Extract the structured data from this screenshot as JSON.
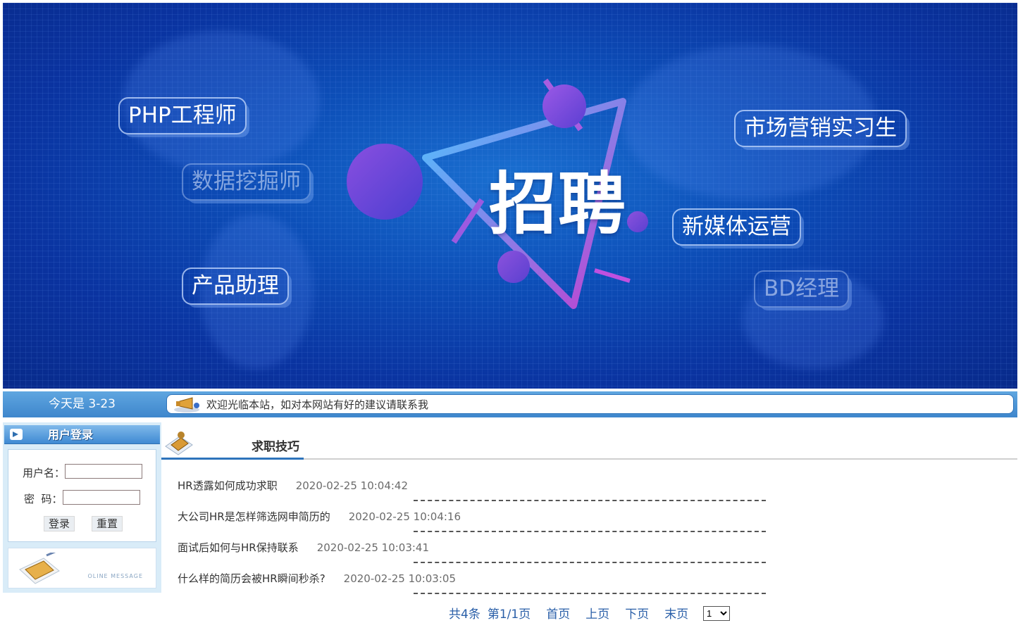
{
  "banner": {
    "hero": "招聘",
    "tags": [
      "PHP工程师",
      "数据挖掘师",
      "产品助理",
      "市场营销实习生",
      "新媒体运营",
      "BD经理"
    ]
  },
  "infobar": {
    "today": "今天是 3-23",
    "notice": "欢迎光临本站，如对本网站有好的建议请联系我"
  },
  "login": {
    "title": "用户登录",
    "username_label": "用户名：",
    "password_label": "密  码：",
    "username_value": "",
    "password_value": "",
    "login_button": "登录",
    "reset_button": "重置",
    "message_label": "OLINE MESSAGE"
  },
  "tips": {
    "title": "求职技巧",
    "articles": [
      {
        "title": "HR透露如何成功求职",
        "date": "2020-02-25 10:04:42"
      },
      {
        "title": "大公司HR是怎样筛选网申简历的",
        "date": "2020-02-25 10:04:16"
      },
      {
        "title": "面试后如何与HR保持联系",
        "date": "2020-02-25 10:03:41"
      },
      {
        "title": "什么样的简历会被HR瞬间秒杀?",
        "date": "2020-02-25 10:03:05"
      }
    ]
  },
  "pager": {
    "total": "共4条",
    "page": "第1/1页",
    "first": "首页",
    "prev": "上页",
    "next": "下页",
    "last": "末页",
    "select_value": "1"
  },
  "colors": {
    "banner_blue": "#0d4fb8",
    "bar_blue": "#3e86cc",
    "link_blue": "#2a5fa8"
  }
}
